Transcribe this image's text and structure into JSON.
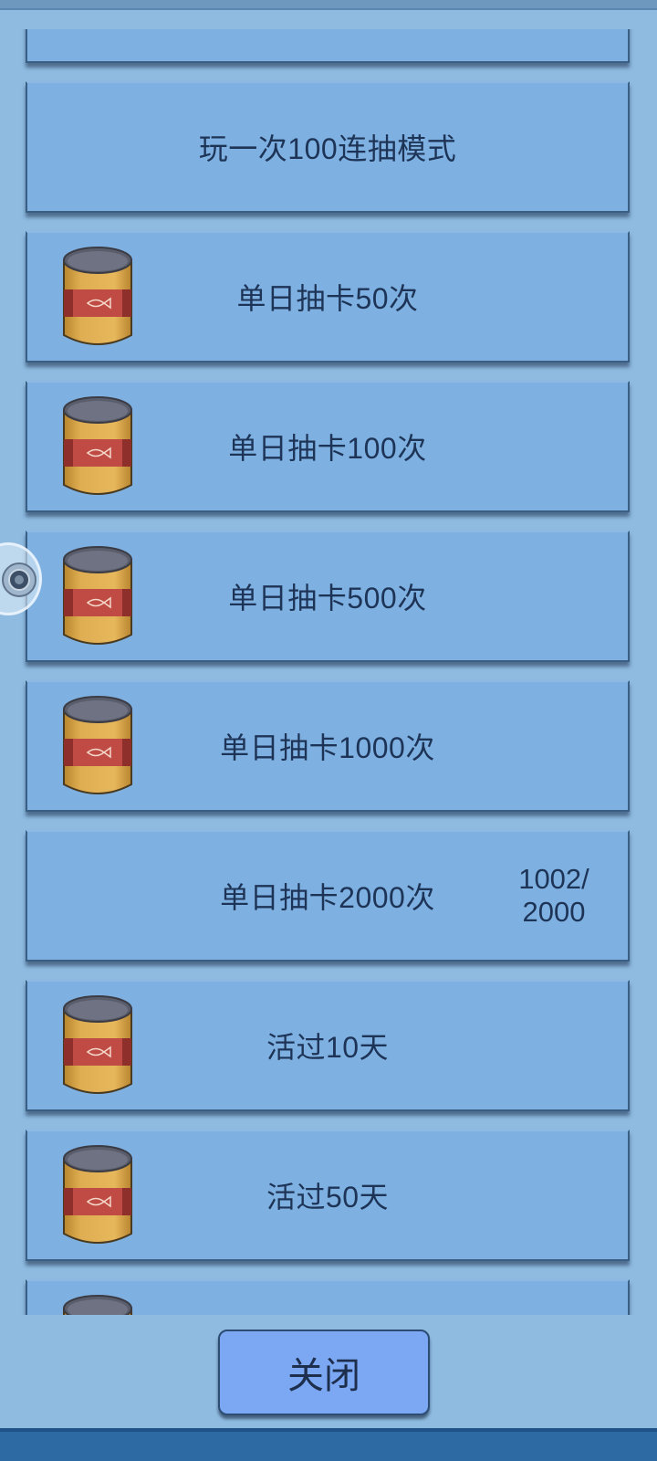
{
  "tasks": [
    {
      "label": "",
      "reward": false,
      "progress": null
    },
    {
      "label": "玩一次100连抽模式",
      "reward": false,
      "progress": null
    },
    {
      "label": "单日抽卡50次",
      "reward": true,
      "progress": null
    },
    {
      "label": "单日抽卡100次",
      "reward": true,
      "progress": null
    },
    {
      "label": "单日抽卡500次",
      "reward": true,
      "progress": null
    },
    {
      "label": "单日抽卡1000次",
      "reward": true,
      "progress": null
    },
    {
      "label": "单日抽卡2000次",
      "reward": false,
      "progress": {
        "current": "1002/",
        "total": "2000"
      }
    },
    {
      "label": "活过10天",
      "reward": true,
      "progress": null
    },
    {
      "label": "活过50天",
      "reward": true,
      "progress": null
    },
    {
      "label": "",
      "reward": true,
      "progress": null
    }
  ],
  "reward_icon": "fish-can-icon",
  "close_label": "关闭",
  "colors": {
    "background": "#8fbbe1",
    "item": "#7eb1e1",
    "text": "#1e3457",
    "button": "#7ba7f3"
  }
}
